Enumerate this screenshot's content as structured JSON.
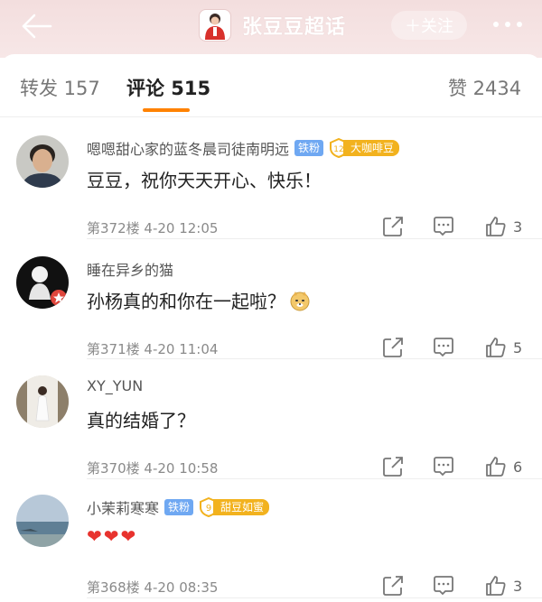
{
  "header": {
    "title": "张豆豆超话",
    "follow_label": "＋关注"
  },
  "tabs": [
    {
      "label": "转发 157"
    },
    {
      "label": "评论 515"
    },
    {
      "label": "赞 2434"
    }
  ],
  "comments": [
    {
      "user": "嗯嗯甜心家的蓝冬晨司徒南明远",
      "fan_badge": "铁粉",
      "level": "12",
      "super_badge": "大咖啡豆",
      "text": "豆豆，祝你天天开心、快乐！",
      "meta": "第372楼  4-20 12:05",
      "likes": "3"
    },
    {
      "user": "睡在异乡的猫",
      "text": "孙杨真的和你在一起啦？",
      "emoji": "doge",
      "meta": "第371楼  4-20 11:04",
      "likes": "5"
    },
    {
      "user": "XY_YUN",
      "text": "真的结婚了？",
      "meta": "第370楼  4-20 10:58",
      "likes": "6"
    },
    {
      "user": "小茉莉寒寒",
      "fan_badge": "铁粉",
      "level": "9",
      "super_badge": "甜豆如蜜",
      "text": "❤❤❤",
      "meta": "第368楼  4-20 08:35",
      "likes": "3"
    }
  ],
  "colors": {
    "accent": "#ff8200",
    "fan_badge": "#6fa8f2",
    "super_badge": "#f2b21e",
    "heart": "#e8332e"
  }
}
